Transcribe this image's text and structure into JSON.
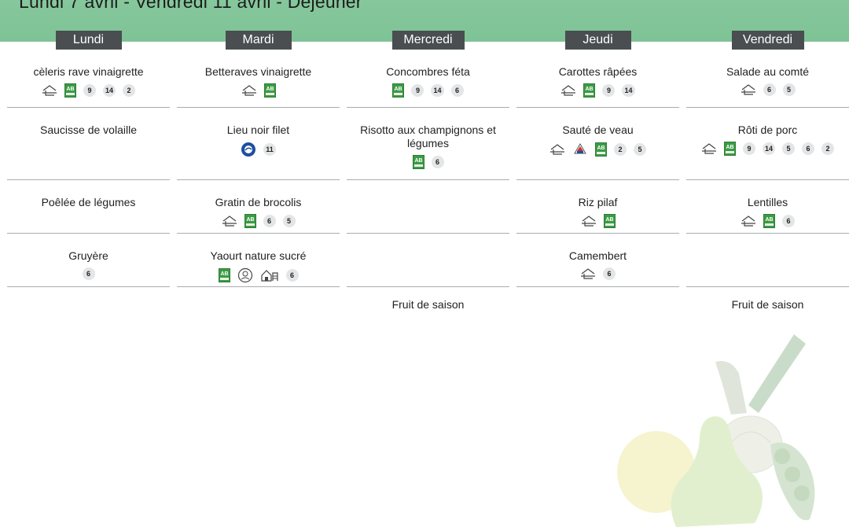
{
  "header": {
    "title": "Lundi 7 avril - Vendredi 11 avril - Déjeuner"
  },
  "days": [
    {
      "name": "Lundi",
      "slots": [
        {
          "dish": "cèleris rave vinaigrette",
          "icons": [
            "fait-maison-icon",
            "bio-ab-icon"
          ],
          "allergens": [
            "9",
            "14",
            "2"
          ]
        },
        {
          "dish": "Saucisse de volaille",
          "icons": [],
          "allergens": []
        },
        {
          "dish": "Poêlée de légumes",
          "icons": [],
          "allergens": []
        },
        {
          "dish": "Gruyère",
          "icons": [],
          "allergens": [
            "6"
          ]
        },
        {
          "dish": "",
          "icons": [],
          "allergens": []
        }
      ]
    },
    {
      "name": "Mardi",
      "slots": [
        {
          "dish": "Betteraves vinaigrette",
          "icons": [
            "fait-maison-icon",
            "bio-ab-icon"
          ],
          "allergens": []
        },
        {
          "dish": "Lieu noir filet",
          "icons": [
            "msc-peche-durable-icon"
          ],
          "allergens": [
            "11"
          ]
        },
        {
          "dish": "Gratin de brocolis",
          "icons": [
            "fait-maison-icon",
            "bio-ab-icon"
          ],
          "allergens": [
            "6",
            "5"
          ]
        },
        {
          "dish": "Yaourt nature sucré",
          "icons": [
            "bio-ab-icon",
            "producteur-local-icon",
            "ferme-icon"
          ],
          "allergens": [
            "6"
          ]
        },
        {
          "dish": "",
          "icons": [],
          "allergens": []
        }
      ]
    },
    {
      "name": "Mercredi",
      "slots": [
        {
          "dish": "Concombres féta",
          "icons": [
            "bio-ab-icon"
          ],
          "allergens": [
            "9",
            "14",
            "6"
          ]
        },
        {
          "dish": "Risotto aux champignons et légumes",
          "icons": [
            "bio-ab-icon"
          ],
          "allergens": [
            "6"
          ]
        },
        {
          "dish": "",
          "icons": [],
          "allergens": []
        },
        {
          "dish": "",
          "icons": [],
          "allergens": []
        },
        {
          "dish": "Fruit de saison",
          "icons": [],
          "allergens": []
        }
      ]
    },
    {
      "name": "Jeudi",
      "slots": [
        {
          "dish": "Carottes râpées",
          "icons": [
            "fait-maison-icon",
            "bio-ab-icon"
          ],
          "allergens": [
            "9",
            "14"
          ]
        },
        {
          "dish": "Sauté de veau",
          "icons": [
            "fait-maison-icon",
            "viande-francaise-icon",
            "bio-ab-icon"
          ],
          "allergens": [
            "2",
            "5"
          ]
        },
        {
          "dish": "Riz pilaf",
          "icons": [
            "fait-maison-icon",
            "bio-ab-icon"
          ],
          "allergens": []
        },
        {
          "dish": "Camembert",
          "icons": [
            "fait-maison-icon"
          ],
          "allergens": [
            "6"
          ]
        },
        {
          "dish": "",
          "icons": [],
          "allergens": []
        }
      ]
    },
    {
      "name": "Vendredi",
      "slots": [
        {
          "dish": "Salade au comté",
          "icons": [
            "fait-maison-icon"
          ],
          "allergens": [
            "6",
            "5"
          ]
        },
        {
          "dish": "Rôti de porc",
          "icons": [
            "fait-maison-icon",
            "bio-ab-icon"
          ],
          "allergens": [
            "9",
            "14",
            "5",
            "6",
            "2"
          ]
        },
        {
          "dish": "Lentilles",
          "icons": [
            "fait-maison-icon",
            "bio-ab-icon"
          ],
          "allergens": [
            "6"
          ]
        },
        {
          "dish": "",
          "icons": [],
          "allergens": []
        },
        {
          "dish": "Fruit de saison",
          "icons": [],
          "allergens": []
        }
      ]
    }
  ],
  "colors": {
    "banner": "#86c79c",
    "day_header_bg": "#4a4e50",
    "bio_green": "#3b9b44",
    "badge_bg": "#e3e5e6",
    "divider": "#a9acaf"
  },
  "decoration": {
    "icon": "fruits-vegetables-illustration"
  }
}
